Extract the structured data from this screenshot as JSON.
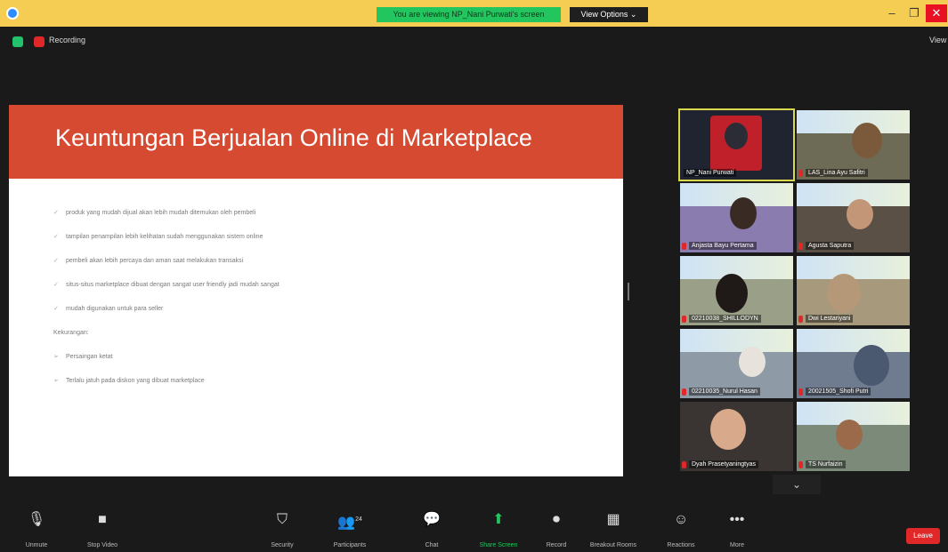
{
  "window": {
    "banner_text": "You are viewing NP_Nani Purwati's screen",
    "view_options": "View Options ⌄",
    "min": "–",
    "max": "❐",
    "close": "✕"
  },
  "topbar": {
    "recording_label": "Recording",
    "view_label": "View"
  },
  "slide": {
    "title": "Keuntungan Berjualan Online di Marketplace",
    "bullets": [
      "produk yang mudah dijual akan lebih mudah ditemukan oleh pembeli",
      "tampilan penampilan lebih kelihatan sudah menggunakan sistem online",
      "pembeli akan lebih percaya dan aman saat melakukan transaksi",
      "situs-situs marketplace dibuat dengan sangat user friendly jadi mudah sangat",
      "mudah digunakan untuk para seller"
    ],
    "sub_heading": "Kekurangan:",
    "cons": [
      "Persaingan ketat",
      "Terlalu jatuh pada diskon yang dibuat marketplace"
    ]
  },
  "gallery": {
    "participants": [
      "NP_Nani Purwati",
      "LAS_Lina Ayu Safitri",
      "Anjasta Bayu Pertama",
      "Agusta Saputra",
      "02210038_SHILLODYN",
      "Dwi Lestariyani",
      "02210035_Nurul Hasan",
      "20021505_Shofi Putri",
      "Dyah Prasetyaningtyas",
      "TS Nurfaizin"
    ],
    "more": "⌄"
  },
  "toolbar": {
    "unmute": "Unmute",
    "stop_video": "Stop Video",
    "security": "Security",
    "participants": "Participants",
    "participants_count": "24",
    "chat": "Chat",
    "share_screen": "Share Screen",
    "record": "Record",
    "breakout": "Breakout Rooms",
    "reactions": "Reactions",
    "more": "More",
    "leave": "Leave"
  },
  "colors": {
    "accent_orange": "#d54a31",
    "share_green": "#22c55e",
    "leave_red": "#e02828"
  }
}
